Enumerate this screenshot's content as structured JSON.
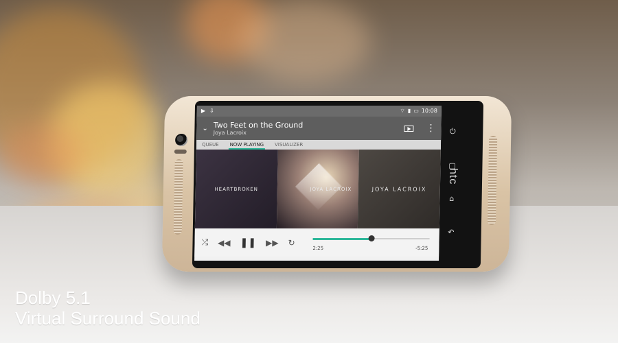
{
  "colors": {
    "accent": "#2db79a",
    "status_bar": "#6b6b6b",
    "header_bar": "#5e5e5e",
    "phone_body": "#dccbb3",
    "screen_bg": "#f1f1f1"
  },
  "status": {
    "time": "10:08"
  },
  "player": {
    "track_title": "Two Feet on the Ground",
    "artist": "Joya Lacroix",
    "tabs": [
      "QUEUE",
      "NOW PLAYING",
      "VISUALIZER"
    ],
    "active_tab_index": 1,
    "albums": [
      {
        "text": "HEARTBROKEN"
      },
      {
        "text": "JOYA LACROIX"
      },
      {
        "text": "JOYA LACROIX"
      }
    ],
    "elapsed": "2:25",
    "remaining": "-5:25",
    "progress_fraction": 0.5
  },
  "icons": {
    "statusbar": [
      "play-icon",
      "download-icon",
      "wifi-icon",
      "signal-icon",
      "battery-icon"
    ],
    "header": [
      "chevron-down-icon",
      "cast-icon",
      "kebab-menu-icon"
    ],
    "controls": [
      "shuffle-icon",
      "rewind-icon",
      "pause-icon",
      "fast-forward-icon",
      "repeat-icon"
    ],
    "nav": [
      "power-icon",
      "recent-apps-icon",
      "home-icon",
      "back-icon"
    ]
  },
  "brand": "htc",
  "caption": {
    "line1": "Dolby 5.1",
    "line2": "Virtual Surround Sound"
  }
}
